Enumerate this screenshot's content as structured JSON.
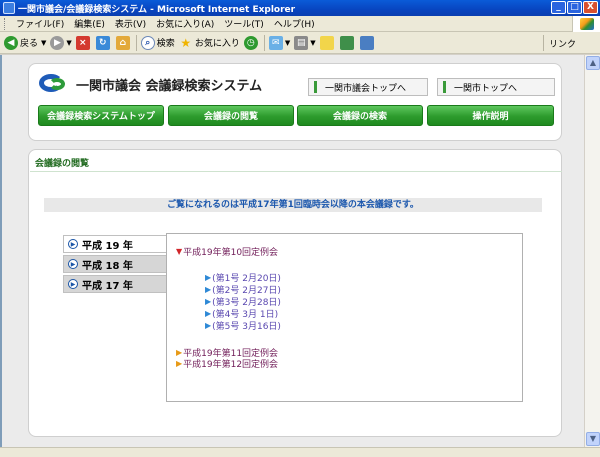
{
  "window": {
    "title": "一関市議会/会議録検索システム - Microsoft Internet Explorer",
    "buttons": {
      "minimize": "_",
      "maximize": "□",
      "close": "X"
    }
  },
  "menubar": {
    "items": [
      "ファイル(F)",
      "編集(E)",
      "表示(V)",
      "お気に入り(A)",
      "ツール(T)",
      "ヘルプ(H)"
    ]
  },
  "toolbar": {
    "back": "戻る",
    "search": "検索",
    "favorites": "お気に入り",
    "links": "リンク"
  },
  "header": {
    "site_title": "一関市議会 会議録検索システム",
    "top_links": [
      "一関市議会トップへ",
      "一関市トップへ"
    ],
    "nav": [
      "会議録検索システムトップ",
      "会議録の閲覧",
      "会議録の検索",
      "操作説明"
    ]
  },
  "main": {
    "section_title": "会議録の閲覧",
    "notice": "ご覧になれるのは平成17年第1回臨時会以降の本会議録です。",
    "years": [
      {
        "label": "平成 19 年",
        "active": true
      },
      {
        "label": "平成 18 年",
        "active": false
      },
      {
        "label": "平成 17 年",
        "active": false
      }
    ],
    "sessions": [
      {
        "label": "平成19年第10回定例会",
        "expanded": true
      },
      {
        "label": "平成19年第11回定例会",
        "expanded": false
      },
      {
        "label": "平成19年第12回定例会",
        "expanded": false
      }
    ],
    "entries": [
      "(第1号 2月20日)",
      "(第2号 2月27日)",
      "(第3号 2月28日)",
      "(第4号 3月 1日)",
      "(第5号 3月16日)"
    ]
  },
  "colors": {
    "nav_green": "#2d9b2d",
    "section_green": "#206a1f",
    "notice_blue": "#1b57ad",
    "session_purple": "#701c58",
    "entry_violet": "#5a48b0"
  }
}
